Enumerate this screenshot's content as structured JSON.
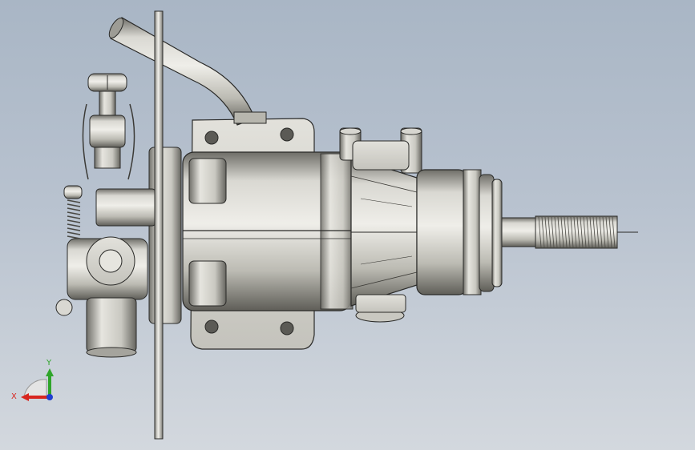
{
  "viewport": {
    "background_top": "#a9b6c5",
    "background_bottom": "#d3d8de"
  },
  "model": {
    "colors": {
      "metal_light": "#e8e8e2",
      "metal_mid": "#b9b8b0",
      "metal_dark": "#7d7c75",
      "edge": "#2a2a28"
    }
  },
  "triad": {
    "x_label": "X",
    "y_label": "Y",
    "x_color": "#d8261f",
    "y_color": "#2fa52a",
    "z_color": "#1f3fd0"
  }
}
